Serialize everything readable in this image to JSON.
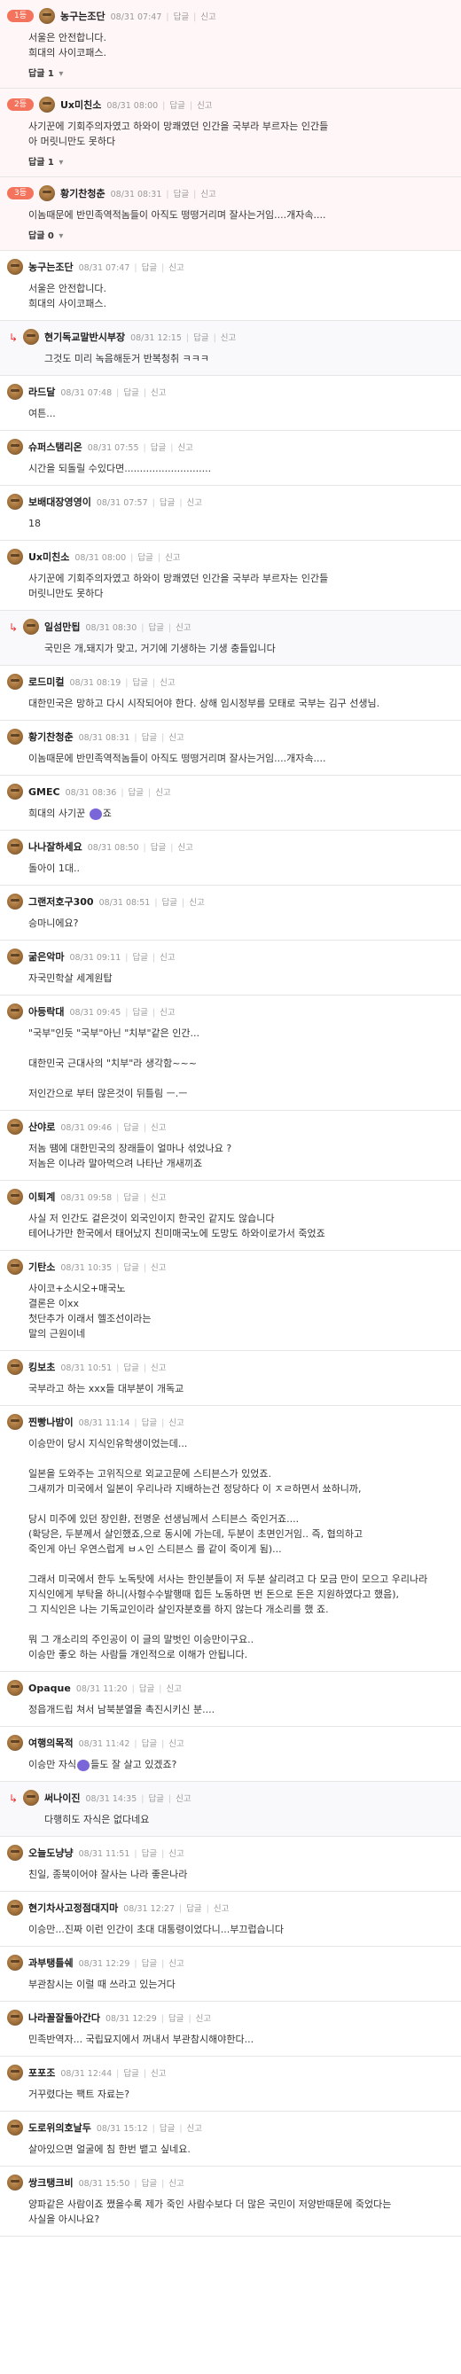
{
  "best": [
    {
      "rank": "1등",
      "nick": "농구는조단",
      "date": "08/31 07:47",
      "reply": "답글",
      "report": "신고",
      "text": [
        "서울은 안전합니다.",
        "희대의 사이코패스."
      ],
      "reco_label": "답글",
      "reco_count": "1"
    },
    {
      "rank": "2등",
      "nick": "Ux미친소",
      "date": "08/31 08:00",
      "reply": "답글",
      "report": "신고",
      "text": [
        "사기꾼에 기회주의자였고 하와이 망쾌였던 인간을 국부라 부르자는 인간들",
        "아 머릿니만도 못하다"
      ],
      "reco_label": "답글",
      "reco_count": "1"
    },
    {
      "rank": "3등",
      "nick": "황기찬청춘",
      "date": "08/31 08:31",
      "reply": "답글",
      "report": "신고",
      "text": [
        "이놈때문에 반민족역적놈들이 아직도 떵떵거리며 잘사는거임....개자속...."
      ],
      "reco_label": "답글",
      "reco_count": "0"
    }
  ],
  "comments": [
    {
      "nick": "농구는조단",
      "date": "08/31 07:47",
      "reply": "답글",
      "report": "신고",
      "text": [
        "서울은 안전합니다.",
        "희대의 사이코패스."
      ]
    },
    {
      "is_reply": true,
      "nick": "현기독교말반시부장",
      "date": "08/31 12:15",
      "reply": "답글",
      "report": "신고",
      "text": [
        "그것도 미리 녹음해둔거 반복청취 ㅋㅋㅋ"
      ]
    },
    {
      "nick": "라드달",
      "date": "08/31 07:48",
      "reply": "답글",
      "report": "신고",
      "text": [
        "여튼..."
      ]
    },
    {
      "nick": "슈퍼스탬리온",
      "date": "08/31 07:55",
      "reply": "답글",
      "report": "신고",
      "text": [
        "시간을 되돌릴 수있다면............................"
      ]
    },
    {
      "nick": "보배대장영영이",
      "date": "08/31 07:57",
      "reply": "답글",
      "report": "신고",
      "text": [
        "18"
      ]
    },
    {
      "nick": "Ux미친소",
      "date": "08/31 08:00",
      "reply": "답글",
      "report": "신고",
      "text": [
        "사기꾼에 기회주의자였고 하와이 망쾌였던 인간을 국부라 부르자는 인간들",
        "머릿니만도 못하다"
      ]
    },
    {
      "is_reply": true,
      "nick": "일섬만됩",
      "date": "08/31 08:30",
      "reply": "답글",
      "report": "신고",
      "text": [
        "국민은 개,돼지가 맞고, 거기에 기생하는 기생 충들입니다"
      ]
    },
    {
      "nick": "로드미컬",
      "date": "08/31 08:19",
      "reply": "답글",
      "report": "신고",
      "text": [
        "대한민국은 망하고 다시 시작되어야 한다. 상해 임시정부를 모태로 국부는 김구 선생님."
      ]
    },
    {
      "nick": "황기찬청춘",
      "date": "08/31 08:31",
      "reply": "답글",
      "report": "신고",
      "text": [
        "이놈때문에 반민족역적놈들이 아직도 떵떵거리며 잘사는거임....개자속...."
      ]
    },
    {
      "nick": "GMEC",
      "date": "08/31 08:36",
      "reply": "답글",
      "report": "신고",
      "text": [
        "희대의 사기꾼 (blur)죠"
      ]
    },
    {
      "nick": "나나잘하세요",
      "date": "08/31 08:50",
      "reply": "답글",
      "report": "신고",
      "text": [
        "돌아이 1대.."
      ]
    },
    {
      "nick": "그랜저호구300",
      "date": "08/31 08:51",
      "reply": "답글",
      "report": "신고",
      "text": [
        "승마니에요?"
      ]
    },
    {
      "nick": "굶은악마",
      "date": "08/31 09:11",
      "reply": "답글",
      "report": "신고",
      "text": [
        "자국민학살 세계원탑"
      ]
    },
    {
      "nick": "아등락대",
      "date": "08/31 09:45",
      "reply": "답글",
      "report": "신고",
      "text": [
        "\"국부\"인듯 \"국부\"아닌 \"치부\"같은 인간...",
        "",
        "대한민국 근대사의 \"치부\"라 생각함~~~",
        "",
        "저인간으로 부터 많은것이 뒤틀림 ㅡ.ㅡ"
      ]
    },
    {
      "nick": "산야로",
      "date": "08/31 09:46",
      "reply": "답글",
      "report": "신고",
      "text": [
        "저놈 땜에 대한민국의 장래들이 얼마나 섞었나요 ?",
        "저놈은 이나라 말아먹으려 나타난 개새끼죠"
      ]
    },
    {
      "nick": "이퇴계",
      "date": "08/31 09:58",
      "reply": "답글",
      "report": "신고",
      "text": [
        "사실 저 인간도 겉은것이 외국인이지 한국인 같지도 않습니다",
        "테어나가만 한국에서 태어났지 친미매국노에 도망도 하와이로가서 죽었죠"
      ]
    },
    {
      "nick": "기탄소",
      "date": "08/31 10:35",
      "reply": "답글",
      "report": "신고",
      "text": [
        "사이코+소시오+매국노",
        "결론은 이xx",
        "첫단추가 이래서 헬조선이라는",
        "말의 근원이네"
      ]
    },
    {
      "nick": "킹보초",
      "date": "08/31 10:51",
      "reply": "답글",
      "report": "신고",
      "text": [
        "국부라고 하는 xxx들 대부분이 개독교"
      ]
    },
    {
      "nick": "찐빵나밤이",
      "date": "08/31 11:14",
      "reply": "답글",
      "report": "신고",
      "text": [
        "이승만이 당시 지식인유학생이었는데...",
        "",
        "일본을 도와주는 고위직으로 외교고문에 스티븐스가 있었죠.",
        "그새끼가 미국에서 일본이 우리나라 지배하는건 정당하다 이 ㅈㄹ하면서 쑈하니까,",
        "",
        "당시 미주에 있던 장인환, 전명운 선생님께서 스티븐스 죽인거죠....",
        "(확당은, 두분께서 살인했죠,으로 동시에 가는데, 두분이 초면인거임.. 즉, 협의하고",
        "죽인게 아닌 우연스럽게 ㅂㅅ인 스티븐스 를 같이 죽이게 됨)...",
        "",
        "그래서 미국에서 한두 노독탓에 서사는 한인분들이 저 두분 살리려고 다 모금 만이 모으고 우리나라",
        "지식인에게 부탁을 하니(사형수수발행때 힙든 노동하면 번 돈으로 돈은 지원하였다고 했음),",
        "그 지식인은 나는 기독교인이라 살인자분호를 하지 않는다 개소리를 했 죠.",
        "",
        "뭐 그 개소리의 주인공이 이 글의 말벗인 이승만이구요..",
        "이승만 좋오 하는 사람들 개인적으로 이해가 안됩니다."
      ]
    },
    {
      "nick": "Opaque",
      "date": "08/31 11:20",
      "reply": "답글",
      "report": "신고",
      "text": [
        "정읍개드립 쳐서 남북분열을 촉진시키신 분...."
      ]
    },
    {
      "nick": "여행의목적",
      "date": "08/31 11:42",
      "reply": "답글",
      "report": "신고",
      "text": [
        "이승만 자식(blur)들도 잘 살고 있겠죠?"
      ]
    },
    {
      "is_reply": true,
      "nick": "써나이진",
      "date": "08/31 14:35",
      "reply": "답글",
      "report": "신고",
      "text": [
        "다행히도 자식은 없다네요"
      ]
    },
    {
      "nick": "오늘도냥냥",
      "date": "08/31 11:51",
      "reply": "답글",
      "report": "신고",
      "text": [
        "친일, 종북이어야 잘사는 나라 좋은나라"
      ]
    },
    {
      "nick": "현기차사고정점대지마",
      "date": "08/31 12:27",
      "reply": "답글",
      "report": "신고",
      "text": [
        "이승만...진짜 이런 인간이 초대 대통령이었다니...부끄럽습니다"
      ]
    },
    {
      "nick": "과부탱틀쉐",
      "date": "08/31 12:29",
      "reply": "답글",
      "report": "신고",
      "text": [
        "부관참시는 이럴 때 쓰라고 있는거다"
      ]
    },
    {
      "nick": "나라꼴잘돌아간다",
      "date": "08/31 12:29",
      "reply": "답글",
      "report": "신고",
      "text": [
        "민족반역자... 국립묘지에서 꺼내서 부관참시해야한다..."
      ]
    },
    {
      "nick": "포포조",
      "date": "08/31 12:44",
      "reply": "답글",
      "report": "신고",
      "text": [
        "거꾸렸다는 팩트 자료는?"
      ]
    },
    {
      "nick": "도로위의호날두",
      "date": "08/31 15:12",
      "reply": "답글",
      "report": "신고",
      "text": [
        "살아있으면 얼굴에 침 한번 뱉고 싶네요."
      ]
    },
    {
      "nick": "쌍크탱크비",
      "date": "08/31 15:50",
      "reply": "답글",
      "report": "신고",
      "text": [
        "양파같은 사람이죠 쪘을수록 제가 죽인 사람수보다 더 많은 국민이 저양반때문에 죽었다는",
        "사실을 아시나요?"
      ]
    }
  ]
}
